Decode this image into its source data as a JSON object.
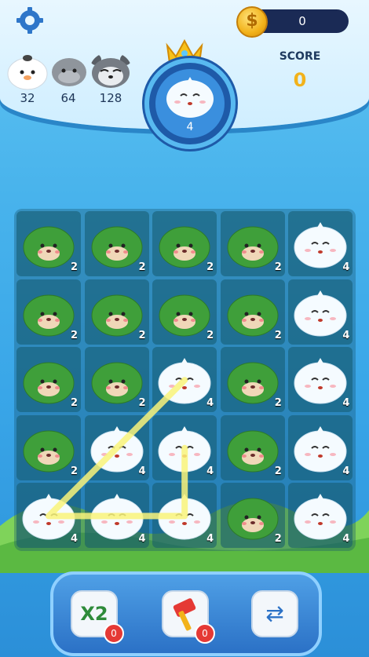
{
  "top": {
    "coins": "0",
    "score_label": "SCORE",
    "score_value": "0",
    "target_level": "4"
  },
  "pets": [
    {
      "name": "white-pet",
      "value": "32"
    },
    {
      "name": "gray-pet",
      "value": "64"
    },
    {
      "name": "raccoon-pet",
      "value": "128"
    }
  ],
  "board": {
    "rows": [
      [
        "2",
        "2",
        "2",
        "2",
        "4"
      ],
      [
        "2",
        "2",
        "2",
        "2",
        "4"
      ],
      [
        "2",
        "2",
        "4",
        "2",
        "4"
      ],
      [
        "2",
        "4",
        "4",
        "2",
        "4"
      ],
      [
        "4",
        "4",
        "4",
        "2",
        "4"
      ]
    ]
  },
  "tools": {
    "x2_label": "X2",
    "x2_count": "0",
    "hammer_count": "0",
    "shuffle_count": ""
  },
  "colors": {
    "green_pet": "#3f9f3a",
    "white_pet": "#f5fbff",
    "gold": "#f2b21a"
  }
}
